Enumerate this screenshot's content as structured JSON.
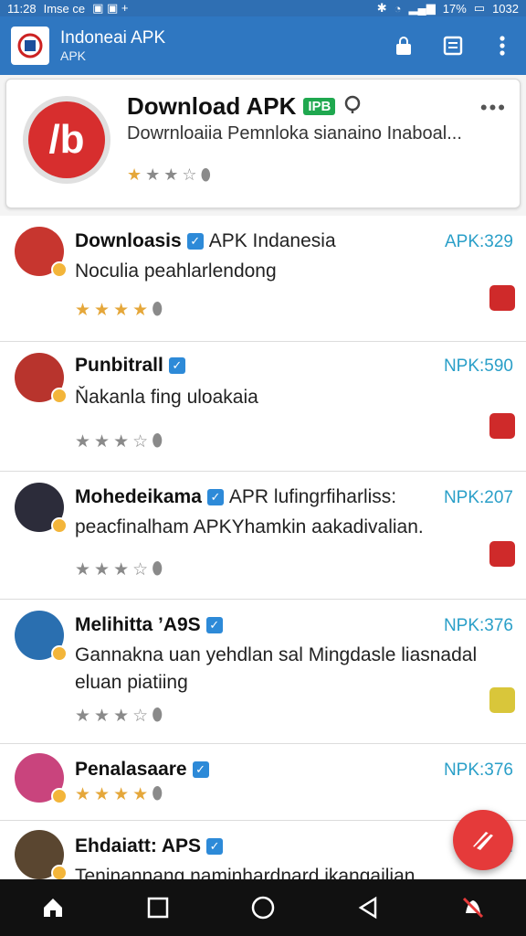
{
  "status_bar": {
    "time": "11:28",
    "text": "Imse ce",
    "battery": "17%",
    "extra": "1032"
  },
  "app_bar": {
    "title": "Indoneai APK",
    "subtitle": "APK"
  },
  "header_card": {
    "title": "Download APK",
    "badge": "IPB",
    "subtitle": "Dowrnloaiia Pemnloka sianaino  Inaboal...",
    "rating_filled": 1,
    "rating_total": 4
  },
  "items": [
    {
      "name": "Downloasis",
      "extra": "APK Indanesia",
      "count": "APK:329",
      "desc": "Noculia peahlarlendong",
      "avatar_color": "#c7362f",
      "stars": 4,
      "stars_gold": true,
      "right_color": "#cf2a2a"
    },
    {
      "name": "Punbitrall",
      "extra": "",
      "count": "NPK:590",
      "desc": "Ňakanla fing uloakaia",
      "avatar_color": "#b8342d",
      "stars": 3,
      "stars_gold": false,
      "right_color": "#cf2a2a"
    },
    {
      "name": "Mohedeikama",
      "extra": "APR lufingrfiharliss:",
      "count": "NPK:207",
      "desc": "peacfinalham APKYhamkin aakadivalian.",
      "avatar_color": "#2c2c3a",
      "stars": 3,
      "stars_gold": false,
      "right_color": "#cf2a2a"
    },
    {
      "name": "Melihitta ’A9S",
      "extra": "",
      "count": "NPK:376",
      "desc": "Gannakna uan yehdlan sal Mingdasle liasnadal eluan piatiing",
      "avatar_color": "#2a6fb0",
      "stars": 3,
      "stars_gold": false,
      "right_color": "#d9c63a"
    },
    {
      "name": "Penalasaare",
      "extra": "",
      "count": "NPK:376",
      "desc": "",
      "avatar_color": "#c9447d",
      "stars": 4,
      "stars_gold": true,
      "right_color": ""
    },
    {
      "name": "Ehdaiatt: APS",
      "extra": "",
      "count": "N",
      "desc": "Teninannang naminhardnard ikangailian.",
      "avatar_color": "#5a4630",
      "stars": 0,
      "stars_gold": false,
      "right_color": ""
    }
  ]
}
